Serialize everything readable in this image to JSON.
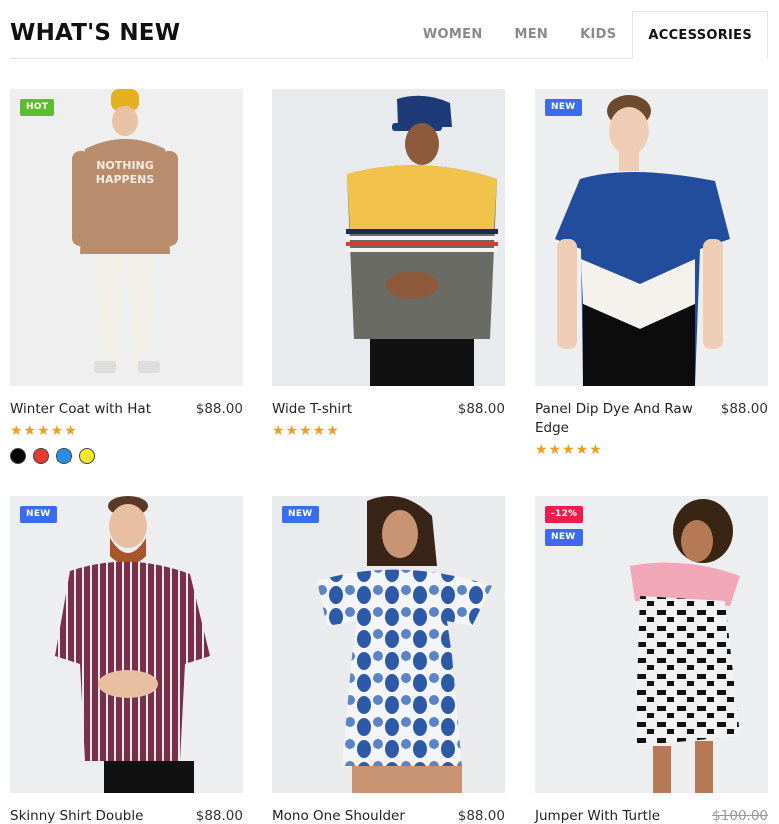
{
  "header": {
    "title": "WHAT'S NEW",
    "tabs": [
      {
        "label": "WOMEN",
        "active": false
      },
      {
        "label": "MEN",
        "active": false
      },
      {
        "label": "KIDS",
        "active": false
      },
      {
        "label": "ACCESSORIES",
        "active": true
      }
    ]
  },
  "colors": {
    "star": "#f49d1a",
    "badge_hot": "#5cbd2e",
    "badge_new": "#3b6bf0",
    "badge_sale": "#ee1d4b"
  },
  "products": [
    {
      "name": "Winter Coat with Hat",
      "price": "$88.00",
      "badges": [
        "HOT"
      ],
      "stars": "★★★★★",
      "rating": 5,
      "swatches": [
        "#000000",
        "#e63b2e",
        "#2b8de8",
        "#f5e62a"
      ]
    },
    {
      "name": "Wide T-shirt",
      "price": "$88.00",
      "badges": [],
      "stars": "★★★★★",
      "rating": 5
    },
    {
      "name": "Panel Dip Dye And Raw Edge",
      "price": "$88.00",
      "badges": [
        "NEW"
      ],
      "stars": "★★★★★",
      "rating": 5
    },
    {
      "name": "Skinny Shirt Double",
      "price": "$88.00",
      "badges": [
        "NEW"
      ]
    },
    {
      "name": "Mono One Shoulder",
      "price": "$88.00",
      "badges": [
        "NEW"
      ]
    },
    {
      "name": "Jumper With Turtle",
      "price": "$100.00",
      "price_struck": true,
      "badges": [
        "-12%",
        "NEW"
      ]
    }
  ]
}
